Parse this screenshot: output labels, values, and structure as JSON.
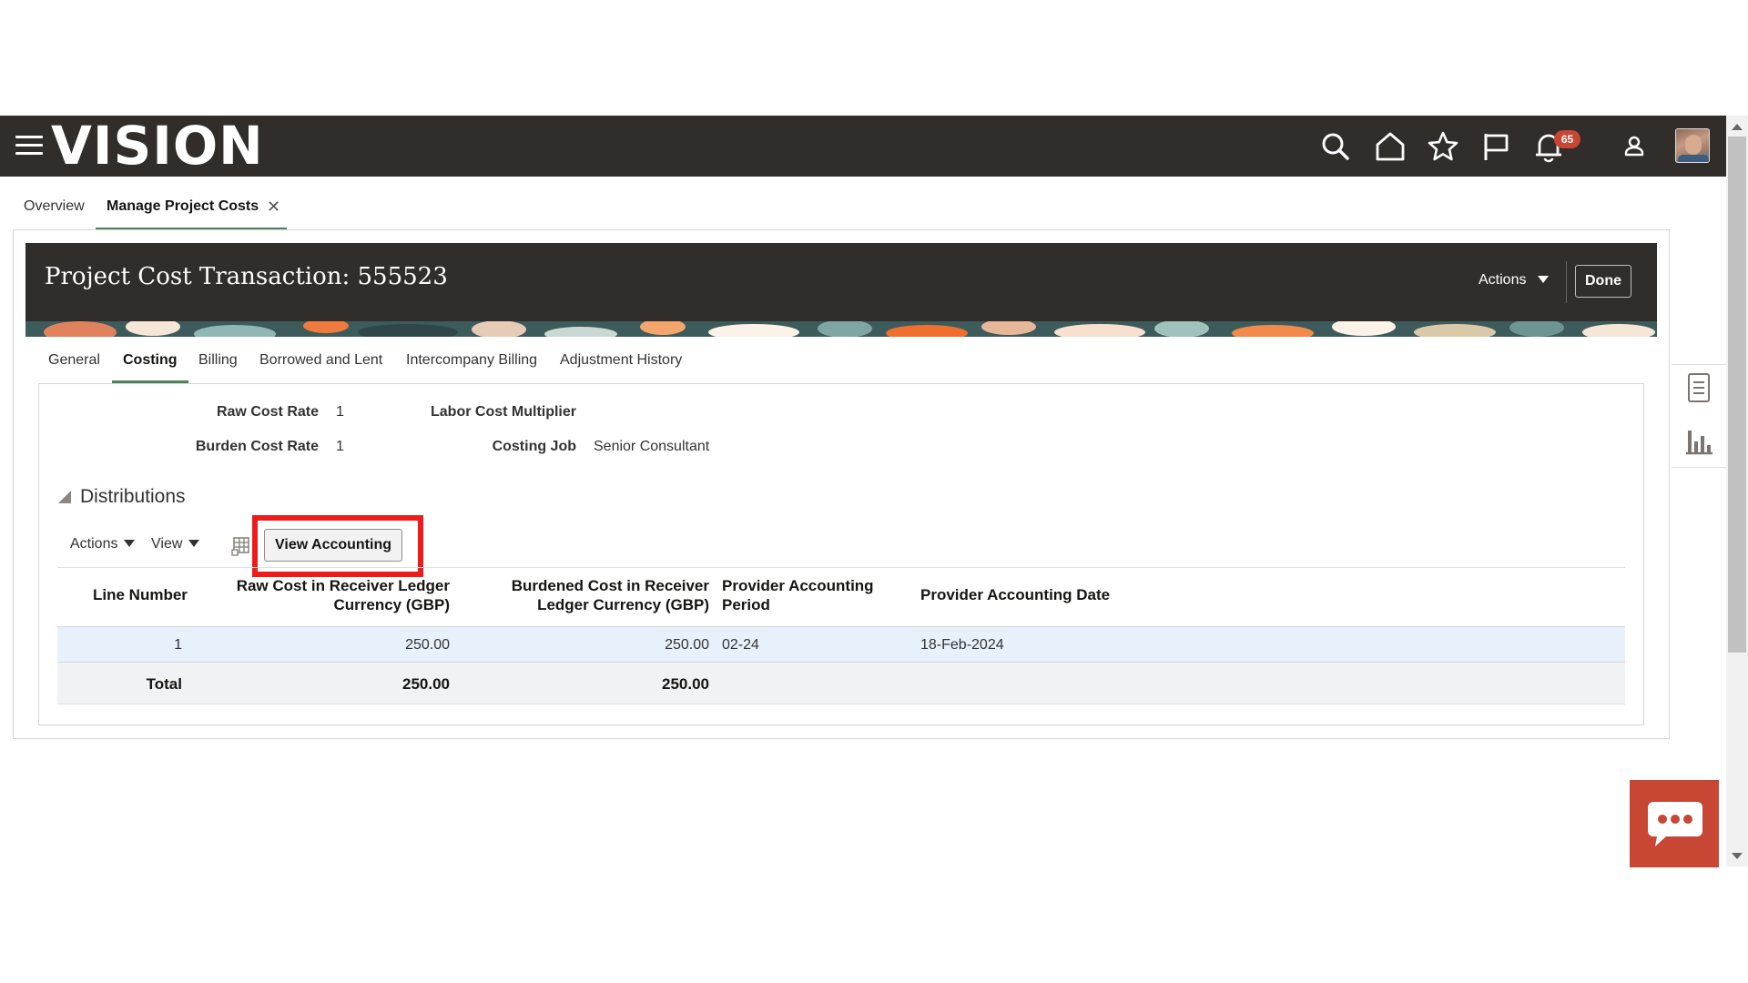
{
  "app": {
    "logo": "VISION",
    "notification_count": "65"
  },
  "page_tabs": [
    {
      "label": "Overview"
    },
    {
      "label": "Manage Project Costs",
      "active": true,
      "closable": true
    }
  ],
  "header": {
    "title": "Project Cost Transaction: 555523",
    "actions_label": "Actions",
    "done_label": "Done"
  },
  "sub_tabs": [
    {
      "label": "General"
    },
    {
      "label": "Costing",
      "active": true
    },
    {
      "label": "Billing"
    },
    {
      "label": "Borrowed and Lent"
    },
    {
      "label": "Intercompany Billing"
    },
    {
      "label": "Adjustment History"
    }
  ],
  "costing": {
    "raw_cost_rate_label": "Raw Cost Rate",
    "raw_cost_rate": "1",
    "burden_cost_rate_label": "Burden Cost Rate",
    "burden_cost_rate": "1",
    "labor_cost_multiplier_label": "Labor Cost Multiplier",
    "costing_job_label": "Costing Job",
    "costing_job": "Senior Consultant"
  },
  "distributions": {
    "title": "Distributions",
    "toolbar": {
      "actions_label": "Actions",
      "view_label": "View",
      "view_accounting_label": "View Accounting"
    },
    "columns": {
      "line_number": "Line Number",
      "raw_cost_l1": "Raw Cost in Receiver Ledger",
      "raw_cost_l2": "Currency (GBP)",
      "burdened_cost_l1": "Burdened Cost in Receiver",
      "burdened_cost_l2": "Ledger Currency (GBP)",
      "period_l1": "Provider Accounting",
      "period_l2": "Period",
      "date": "Provider Accounting Date"
    },
    "rows": [
      {
        "line_number": "1",
        "raw_cost": "250.00",
        "burdened_cost": "250.00",
        "period": "02-24",
        "date": "18-Feb-2024"
      }
    ],
    "total": {
      "label": "Total",
      "raw_cost": "250.00",
      "burdened_cost": "250.00"
    }
  },
  "colors": {
    "topbar": "#312d2a",
    "active_tab_underline": "#4c825c",
    "highlight_box": "#ef1b1b",
    "selected_row": "#e6f1fb",
    "badge": "#c74634",
    "chat_button": "#c74634"
  },
  "icons": [
    "menu-icon",
    "search-icon",
    "home-icon",
    "favorites-star-icon",
    "flag-icon",
    "notifications-bell-icon",
    "user-icon",
    "table-grid-icon",
    "document-icon",
    "bar-chart-icon",
    "chat-icon"
  ]
}
